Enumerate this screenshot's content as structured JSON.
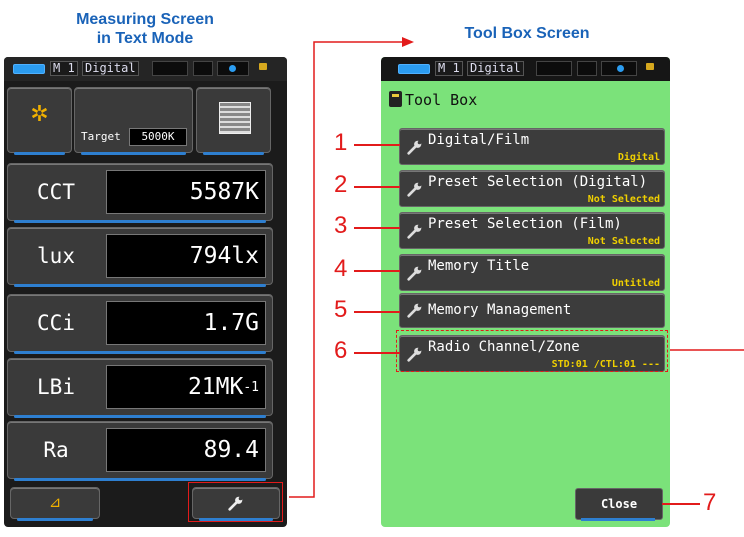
{
  "headings": {
    "left_line1": "Measuring Screen",
    "left_line2": "in Text Mode",
    "right": "Tool Box Screen"
  },
  "status_bar": {
    "memory": "M 1",
    "mode": "Digital"
  },
  "measuring": {
    "target_label": "Target",
    "target_value": "5000K",
    "rows": [
      {
        "label": "CCT",
        "value": "5587K"
      },
      {
        "label": "lux",
        "value": "794lx"
      },
      {
        "label": "CCi",
        "value": "1.7G"
      },
      {
        "label": "LBi",
        "value": "21MK",
        "sup": "-1"
      },
      {
        "label": "Ra",
        "value": "89.4"
      }
    ],
    "bottom_left_icon": "triangle-icon",
    "bottom_right_icon": "wrench-icon"
  },
  "toolbox": {
    "title": "Tool Box",
    "items": [
      {
        "label": "Digital/Film",
        "value": "Digital"
      },
      {
        "label": "Preset Selection (Digital)",
        "value": "Not Selected"
      },
      {
        "label": "Preset Selection (Film)",
        "value": "Not Selected"
      },
      {
        "label": "Memory Title",
        "value": "Untitled"
      },
      {
        "label": "Memory Management",
        "value": ""
      },
      {
        "label": "Radio Channel/Zone",
        "value": "STD:01 /CTL:01 ---"
      }
    ],
    "close_label": "Close"
  },
  "callouts": [
    "1",
    "2",
    "3",
    "4",
    "5",
    "6",
    "7"
  ],
  "colors": {
    "heading": "#1a63b8",
    "callout": "#e21b1b",
    "toolbox_bg": "#7be27a",
    "value_text": "#f0d000",
    "accent_blue": "#2e7fd0"
  }
}
